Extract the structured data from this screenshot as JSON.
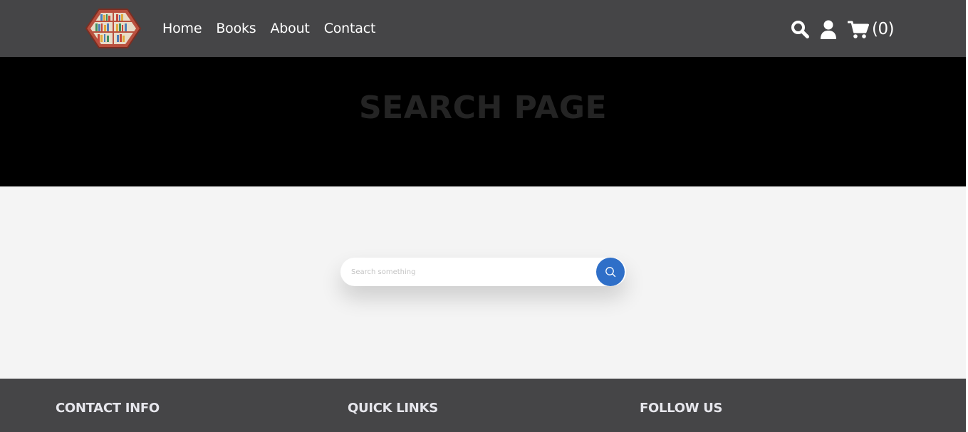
{
  "header": {
    "logo_icon": "bookshelf-logo-icon",
    "nav": [
      {
        "label": "Home"
      },
      {
        "label": "Books"
      },
      {
        "label": "About"
      },
      {
        "label": "Contact"
      }
    ],
    "actions": {
      "search_icon": "search-icon",
      "user_icon": "user-icon",
      "cart_icon": "cart-icon",
      "cart_count": "(0)"
    }
  },
  "hero": {
    "title": "SEARCH PAGE"
  },
  "search": {
    "placeholder": "Search something",
    "value": "",
    "button_icon": "search-icon"
  },
  "footer": {
    "columns": [
      {
        "heading": "CONTACT INFO"
      },
      {
        "heading": "QUICK LINKS"
      },
      {
        "heading": "FOLLOW US"
      }
    ]
  },
  "colors": {
    "header_bg": "#454547",
    "hero_bg": "#000000",
    "hero_title": "#242424",
    "page_bg": "#f4f4f4",
    "accent": "#2f6fc8",
    "footer_heading": "#e6e6ec"
  }
}
